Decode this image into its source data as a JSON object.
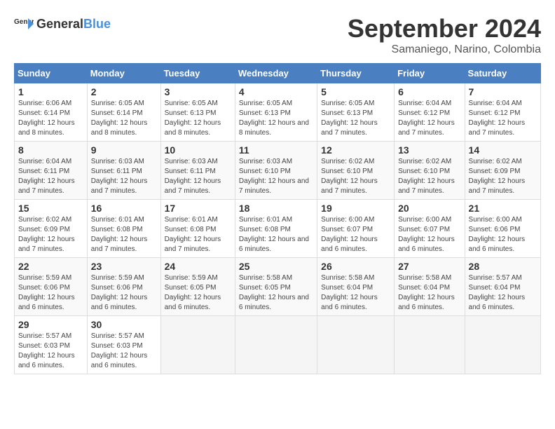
{
  "logo": {
    "general": "General",
    "blue": "Blue"
  },
  "title": "September 2024",
  "subtitle": "Samaniego, Narino, Colombia",
  "days_of_week": [
    "Sunday",
    "Monday",
    "Tuesday",
    "Wednesday",
    "Thursday",
    "Friday",
    "Saturday"
  ],
  "weeks": [
    [
      {
        "day": "1",
        "sunrise": "6:06 AM",
        "sunset": "6:14 PM",
        "daylight": "12 hours and 8 minutes."
      },
      {
        "day": "2",
        "sunrise": "6:05 AM",
        "sunset": "6:14 PM",
        "daylight": "12 hours and 8 minutes."
      },
      {
        "day": "3",
        "sunrise": "6:05 AM",
        "sunset": "6:13 PM",
        "daylight": "12 hours and 8 minutes."
      },
      {
        "day": "4",
        "sunrise": "6:05 AM",
        "sunset": "6:13 PM",
        "daylight": "12 hours and 8 minutes."
      },
      {
        "day": "5",
        "sunrise": "6:05 AM",
        "sunset": "6:13 PM",
        "daylight": "12 hours and 7 minutes."
      },
      {
        "day": "6",
        "sunrise": "6:04 AM",
        "sunset": "6:12 PM",
        "daylight": "12 hours and 7 minutes."
      },
      {
        "day": "7",
        "sunrise": "6:04 AM",
        "sunset": "6:12 PM",
        "daylight": "12 hours and 7 minutes."
      }
    ],
    [
      {
        "day": "8",
        "sunrise": "6:04 AM",
        "sunset": "6:11 PM",
        "daylight": "12 hours and 7 minutes."
      },
      {
        "day": "9",
        "sunrise": "6:03 AM",
        "sunset": "6:11 PM",
        "daylight": "12 hours and 7 minutes."
      },
      {
        "day": "10",
        "sunrise": "6:03 AM",
        "sunset": "6:11 PM",
        "daylight": "12 hours and 7 minutes."
      },
      {
        "day": "11",
        "sunrise": "6:03 AM",
        "sunset": "6:10 PM",
        "daylight": "12 hours and 7 minutes."
      },
      {
        "day": "12",
        "sunrise": "6:02 AM",
        "sunset": "6:10 PM",
        "daylight": "12 hours and 7 minutes."
      },
      {
        "day": "13",
        "sunrise": "6:02 AM",
        "sunset": "6:10 PM",
        "daylight": "12 hours and 7 minutes."
      },
      {
        "day": "14",
        "sunrise": "6:02 AM",
        "sunset": "6:09 PM",
        "daylight": "12 hours and 7 minutes."
      }
    ],
    [
      {
        "day": "15",
        "sunrise": "6:02 AM",
        "sunset": "6:09 PM",
        "daylight": "12 hours and 7 minutes."
      },
      {
        "day": "16",
        "sunrise": "6:01 AM",
        "sunset": "6:08 PM",
        "daylight": "12 hours and 7 minutes."
      },
      {
        "day": "17",
        "sunrise": "6:01 AM",
        "sunset": "6:08 PM",
        "daylight": "12 hours and 7 minutes."
      },
      {
        "day": "18",
        "sunrise": "6:01 AM",
        "sunset": "6:08 PM",
        "daylight": "12 hours and 6 minutes."
      },
      {
        "day": "19",
        "sunrise": "6:00 AM",
        "sunset": "6:07 PM",
        "daylight": "12 hours and 6 minutes."
      },
      {
        "day": "20",
        "sunrise": "6:00 AM",
        "sunset": "6:07 PM",
        "daylight": "12 hours and 6 minutes."
      },
      {
        "day": "21",
        "sunrise": "6:00 AM",
        "sunset": "6:06 PM",
        "daylight": "12 hours and 6 minutes."
      }
    ],
    [
      {
        "day": "22",
        "sunrise": "5:59 AM",
        "sunset": "6:06 PM",
        "daylight": "12 hours and 6 minutes."
      },
      {
        "day": "23",
        "sunrise": "5:59 AM",
        "sunset": "6:06 PM",
        "daylight": "12 hours and 6 minutes."
      },
      {
        "day": "24",
        "sunrise": "5:59 AM",
        "sunset": "6:05 PM",
        "daylight": "12 hours and 6 minutes."
      },
      {
        "day": "25",
        "sunrise": "5:58 AM",
        "sunset": "6:05 PM",
        "daylight": "12 hours and 6 minutes."
      },
      {
        "day": "26",
        "sunrise": "5:58 AM",
        "sunset": "6:04 PM",
        "daylight": "12 hours and 6 minutes."
      },
      {
        "day": "27",
        "sunrise": "5:58 AM",
        "sunset": "6:04 PM",
        "daylight": "12 hours and 6 minutes."
      },
      {
        "day": "28",
        "sunrise": "5:57 AM",
        "sunset": "6:04 PM",
        "daylight": "12 hours and 6 minutes."
      }
    ],
    [
      {
        "day": "29",
        "sunrise": "5:57 AM",
        "sunset": "6:03 PM",
        "daylight": "12 hours and 6 minutes."
      },
      {
        "day": "30",
        "sunrise": "5:57 AM",
        "sunset": "6:03 PM",
        "daylight": "12 hours and 6 minutes."
      },
      null,
      null,
      null,
      null,
      null
    ]
  ],
  "labels": {
    "sunrise": "Sunrise:",
    "sunset": "Sunset:",
    "daylight": "Daylight:"
  }
}
